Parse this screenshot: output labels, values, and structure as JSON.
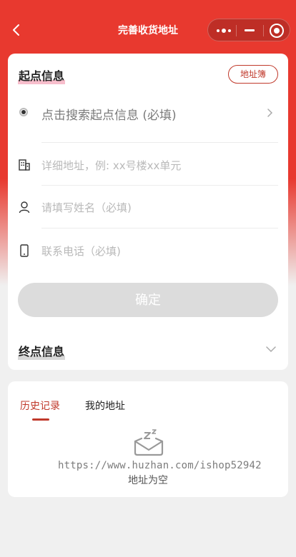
{
  "nav": {
    "title": "完善收货地址"
  },
  "start_section": {
    "title": "起点信息",
    "address_book_label": "地址簿",
    "search_placeholder": "点击搜索起点信息 (必填)",
    "detail_placeholder": "详细地址，例: xx号楼xx单元",
    "name_placeholder": "请填写姓名（必填)",
    "phone_placeholder": "联系电话（必填)",
    "confirm_label": "确定"
  },
  "end_section": {
    "title": "终点信息"
  },
  "history": {
    "tabs": [
      {
        "label": "历史记录",
        "active": true
      },
      {
        "label": "我的地址",
        "active": false
      }
    ],
    "watermark": "https://www.huzhan.com/ishop52942",
    "empty_text": "地址为空"
  },
  "colors": {
    "brand_red": "#e8392f",
    "accent": "#c0392b"
  }
}
